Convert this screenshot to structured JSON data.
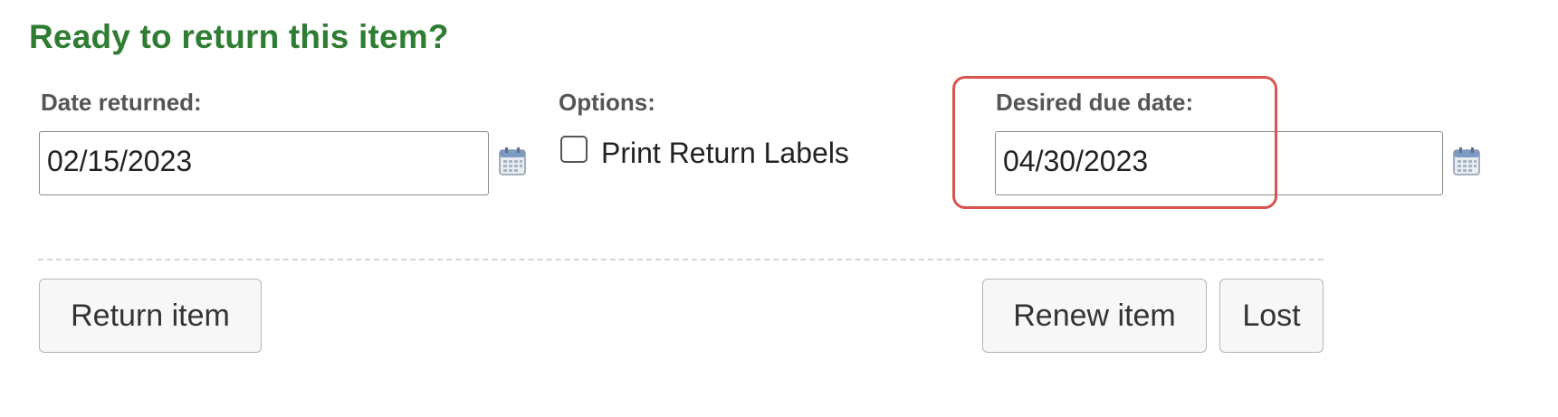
{
  "title": "Ready to return this item?",
  "date_returned": {
    "label": "Date returned:",
    "value": "02/15/2023"
  },
  "options": {
    "label": "Options:",
    "checkbox_label": "Print Return Labels",
    "checked": false
  },
  "desired_due_date": {
    "label": "Desired due date:",
    "value": "04/30/2023"
  },
  "buttons": {
    "return": "Return item",
    "renew": "Renew item",
    "lost": "Lost"
  },
  "icons": {
    "calendar": "calendar-icon"
  },
  "colors": {
    "title": "#2e7d32",
    "highlight": "#d9534f"
  }
}
